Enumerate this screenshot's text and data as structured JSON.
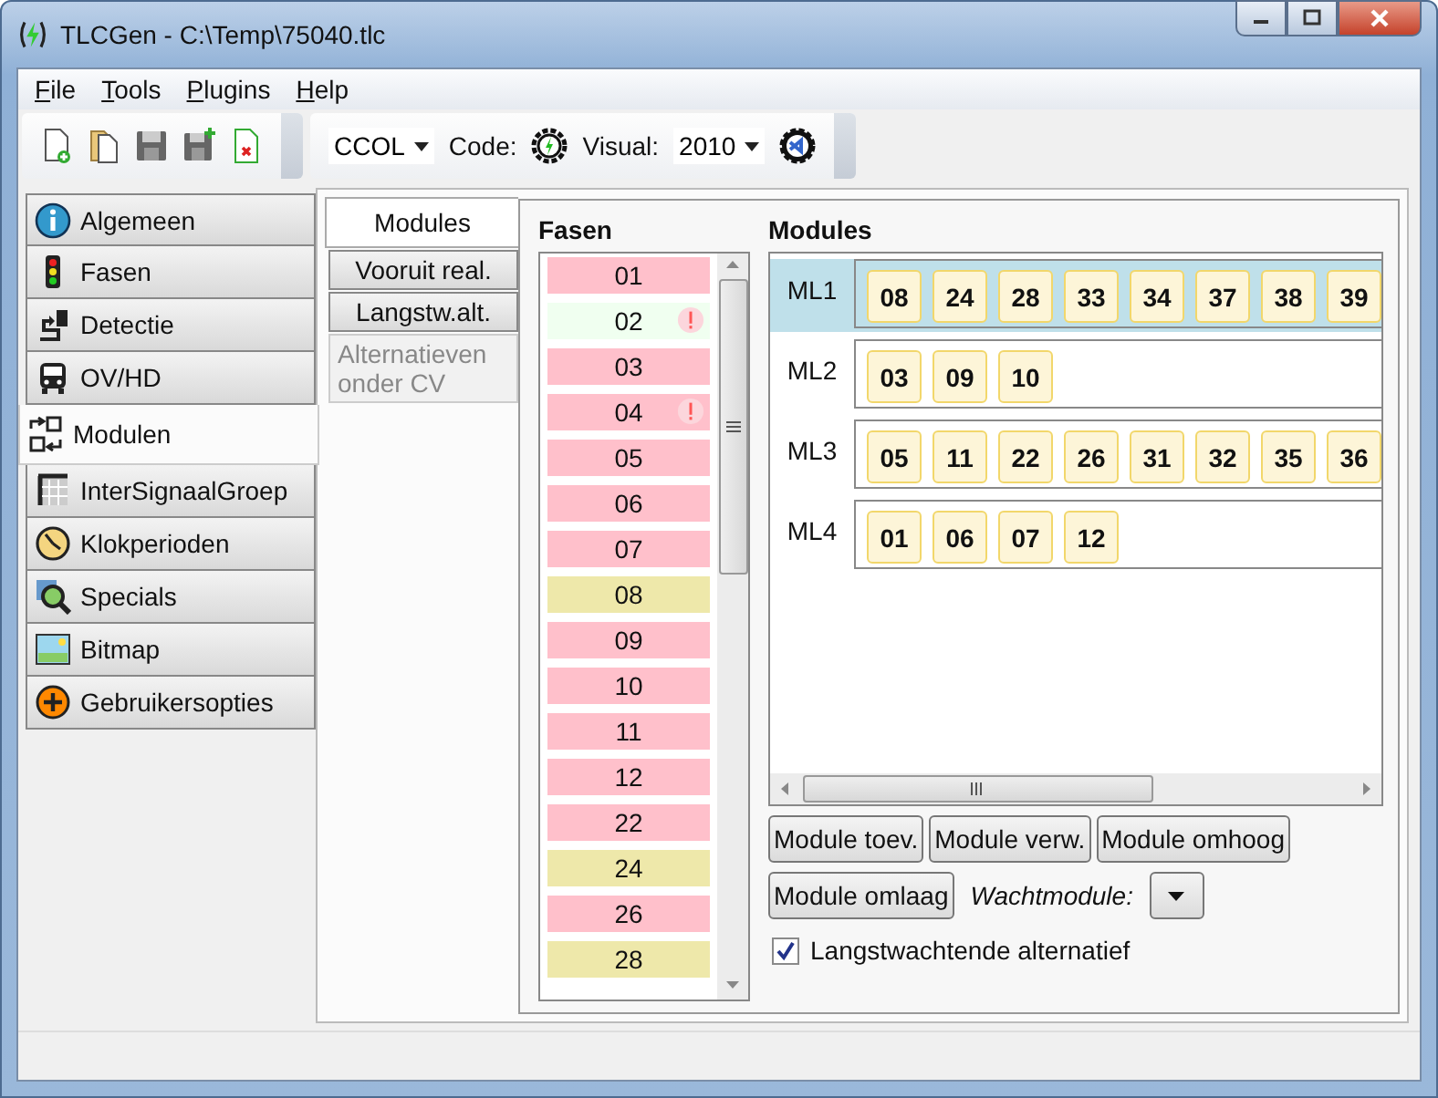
{
  "window": {
    "title": "TLCGen - C:\\Temp\\75040.tlc"
  },
  "menu": [
    "File",
    "Tools",
    "Plugins",
    "Help"
  ],
  "toolbar": {
    "generator": "CCOL",
    "code_label": "Code:",
    "visual_label": "Visual:",
    "visual_version": "2010"
  },
  "sidebar": {
    "items": [
      {
        "label": "Algemeen",
        "selected": false
      },
      {
        "label": "Fasen",
        "selected": false
      },
      {
        "label": "Detectie",
        "selected": false
      },
      {
        "label": "OV/HD",
        "selected": false
      },
      {
        "label": "Modulen",
        "selected": true
      },
      {
        "label": "InterSignaalGroep",
        "selected": false
      },
      {
        "label": "Klokperioden",
        "selected": false
      },
      {
        "label": "Specials",
        "selected": false
      },
      {
        "label": "Bitmap",
        "selected": false
      },
      {
        "label": "Gebruikersopties",
        "selected": false
      }
    ]
  },
  "subtabs": [
    {
      "label": "Modules",
      "selected": true,
      "disabled": false
    },
    {
      "label": "Vooruit real.",
      "selected": false,
      "disabled": false
    },
    {
      "label": "Langstw.alt.",
      "selected": false,
      "disabled": false
    },
    {
      "label": "Alternatieven onder CV",
      "selected": false,
      "disabled": true
    }
  ],
  "fasen": {
    "title": "Fasen",
    "items": [
      {
        "label": "01",
        "color": "#ffc0cb",
        "warning": false
      },
      {
        "label": "02",
        "color": "#f0fff0",
        "warning": true
      },
      {
        "label": "03",
        "color": "#ffc0cb",
        "warning": false
      },
      {
        "label": "04",
        "color": "#ffc0cb",
        "warning": true
      },
      {
        "label": "05",
        "color": "#ffc0cb",
        "warning": false
      },
      {
        "label": "06",
        "color": "#ffc0cb",
        "warning": false
      },
      {
        "label": "07",
        "color": "#ffc0cb",
        "warning": false
      },
      {
        "label": "08",
        "color": "#eee8aa",
        "warning": false
      },
      {
        "label": "09",
        "color": "#ffc0cb",
        "warning": false
      },
      {
        "label": "10",
        "color": "#ffc0cb",
        "warning": false
      },
      {
        "label": "11",
        "color": "#ffc0cb",
        "warning": false
      },
      {
        "label": "12",
        "color": "#ffc0cb",
        "warning": false
      },
      {
        "label": "22",
        "color": "#ffc0cb",
        "warning": false
      },
      {
        "label": "24",
        "color": "#eee8aa",
        "warning": false
      },
      {
        "label": "26",
        "color": "#ffc0cb",
        "warning": false
      },
      {
        "label": "28",
        "color": "#eee8aa",
        "warning": false
      }
    ]
  },
  "modules": {
    "title": "Modules",
    "rows": [
      {
        "label": "ML1",
        "selected": true,
        "phases": [
          "08",
          "24",
          "28",
          "33",
          "34",
          "37",
          "38",
          "39"
        ]
      },
      {
        "label": "ML2",
        "selected": false,
        "phases": [
          "03",
          "09",
          "10"
        ]
      },
      {
        "label": "ML3",
        "selected": false,
        "phases": [
          "05",
          "11",
          "22",
          "26",
          "31",
          "32",
          "35",
          "36"
        ]
      },
      {
        "label": "ML4",
        "selected": false,
        "phases": [
          "01",
          "06",
          "07",
          "12"
        ]
      }
    ]
  },
  "buttons": [
    "Module toev.",
    "Module verw.",
    "Module omhoog",
    "Module omlaag"
  ],
  "wachtmodule": {
    "label": "Wachtmodule:"
  },
  "checkbox": {
    "label": "Langstwachtende alternatief",
    "checked": true
  }
}
